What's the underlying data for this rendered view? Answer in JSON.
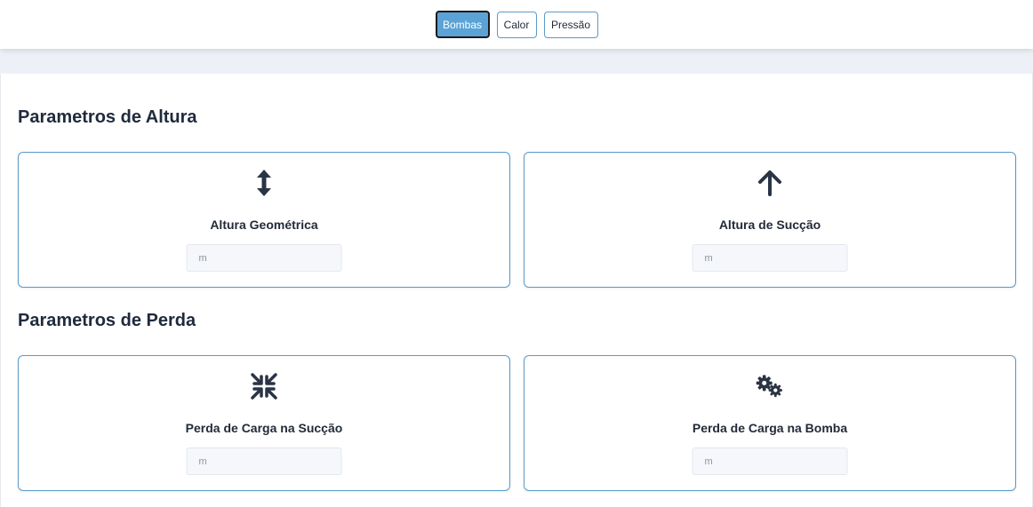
{
  "nav": {
    "tabs": [
      {
        "label": "Bombas",
        "active": true
      },
      {
        "label": "Calor",
        "active": false
      },
      {
        "label": "Pressão",
        "active": false
      }
    ]
  },
  "sections": [
    {
      "title": "Parametros de Altura",
      "cards": [
        {
          "label": "Altura Geométrica",
          "icon": "up-down-arrow-icon",
          "placeholder": "m",
          "value": ""
        },
        {
          "label": "Altura de Sucção",
          "icon": "up-arrow-icon",
          "placeholder": "m",
          "value": ""
        }
      ]
    },
    {
      "title": "Parametros de Perda",
      "cards": [
        {
          "label": "Perda de Carga na Sucção",
          "icon": "compress-icon",
          "placeholder": "m",
          "value": ""
        },
        {
          "label": "Perda de Carga na Bomba",
          "icon": "gears-icon",
          "placeholder": "m",
          "value": ""
        }
      ]
    }
  ],
  "colors": {
    "accent": "#5ba3d6",
    "card_border": "#5b9bc9",
    "text_dark": "#1f2a3c",
    "icon": "#2b3445"
  }
}
